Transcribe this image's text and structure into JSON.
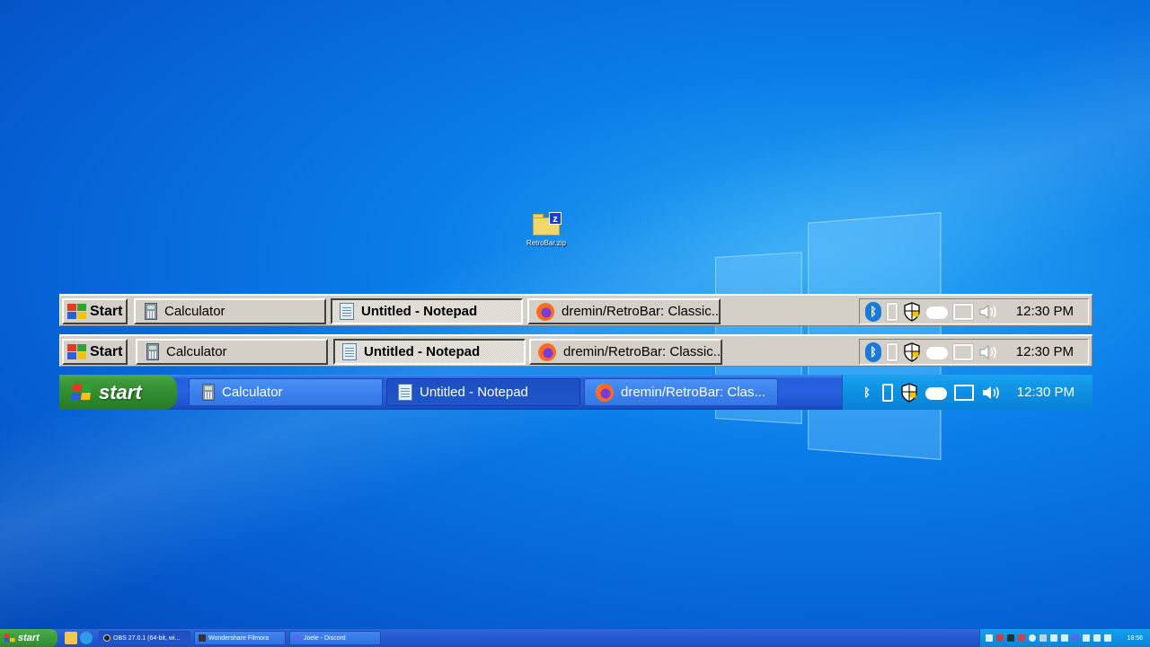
{
  "desktop": {
    "icons": [
      {
        "label": "RetroBar.zip",
        "icon": "zip-folder-icon"
      }
    ]
  },
  "taskbars": {
    "classic_a": {
      "start_label": "Start",
      "tasks": [
        {
          "label": "Calculator",
          "icon": "calculator-icon",
          "active": false
        },
        {
          "label": "Untitled - Notepad",
          "icon": "notepad-icon",
          "active": true
        },
        {
          "label": "dremin/RetroBar: Classic...",
          "icon": "firefox-icon",
          "active": false
        }
      ],
      "tray_icons": [
        "bluetooth-icon",
        "usb-icon",
        "security-shield-icon",
        "onedrive-cloud-icon",
        "network-icon",
        "volume-icon"
      ],
      "clock": "12:30 PM"
    },
    "classic_b": {
      "start_label": "Start",
      "tasks": [
        {
          "label": "Calculator",
          "icon": "calculator-icon",
          "active": false
        },
        {
          "label": "Untitled - Notepad",
          "icon": "notepad-icon",
          "active": true
        },
        {
          "label": "dremin/RetroBar: Classic...",
          "icon": "firefox-icon",
          "active": false
        }
      ],
      "tray_icons": [
        "bluetooth-icon",
        "usb-icon",
        "security-shield-icon",
        "onedrive-cloud-icon",
        "network-icon",
        "volume-icon"
      ],
      "clock": "12:30 PM"
    },
    "xp": {
      "start_label": "start",
      "tasks": [
        {
          "label": "Calculator",
          "icon": "calculator-icon",
          "active": false
        },
        {
          "label": "Untitled - Notepad",
          "icon": "notepad-icon",
          "active": true
        },
        {
          "label": "dremin/RetroBar: Clas...",
          "icon": "firefox-icon",
          "active": false
        }
      ],
      "tray_icons": [
        "bluetooth-icon",
        "usb-icon",
        "security-shield-icon",
        "onedrive-cloud-icon",
        "network-icon",
        "volume-icon"
      ],
      "clock": "12:30 PM"
    },
    "system": {
      "start_label": "start",
      "quick_launch": [
        "folder-icon",
        "edge-icon"
      ],
      "tasks": [
        {
          "label": "OBS 27.0.1 (64-bit, wi...",
          "icon": "obs-icon",
          "active": true
        },
        {
          "label": "Wondershare Filmora",
          "icon": "filmora-icon",
          "active": false
        },
        {
          "label": "Joele - Discord",
          "icon": "discord-icon",
          "active": false
        }
      ],
      "clock": "18:56"
    }
  },
  "colors": {
    "classic_face": "#d4d0c8",
    "xp_blue": "#245edb",
    "xp_green": "#3c9a3b",
    "xp_tray": "#0e90e3"
  }
}
